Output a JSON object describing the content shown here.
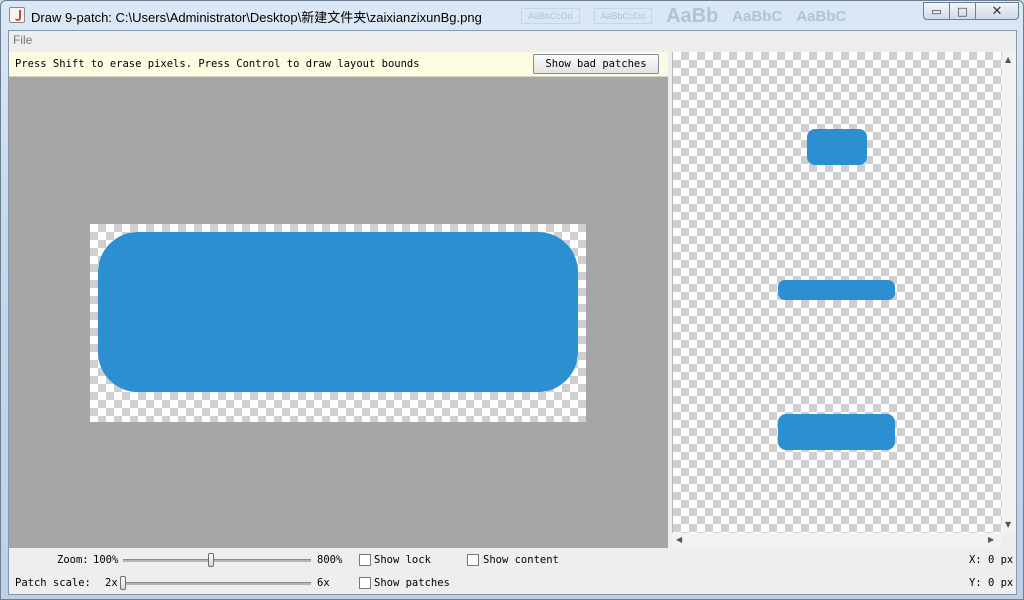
{
  "window": {
    "title": "Draw 9-patch: C:\\Users\\Administrator\\Desktop\\新建文件夹\\zaixianzixunBg.png",
    "min_glyph": "▭",
    "max_glyph": "□",
    "close_glyph": "✕",
    "background_ghost": [
      "AaBbCcDd",
      "AaBbCcDd",
      "AaBb",
      "AaBbC",
      "AaBbC"
    ]
  },
  "menu": {
    "file": "File"
  },
  "hint": {
    "text": "Press Shift to erase pixels. Press Control to draw layout bounds",
    "button": "Show bad patches"
  },
  "colors": {
    "patch_fill": "#2b8fd1",
    "editor_bg": "#a6a6a6",
    "hint_bg": "#fdfbe2"
  },
  "controls": {
    "zoom_label": "Zoom:",
    "zoom_min": "100%",
    "zoom_max": "800%",
    "zoom_value": 0.47,
    "patch_scale_label": "Patch scale:",
    "patch_min": "2x",
    "patch_max": "6x",
    "patch_value": 0,
    "show_lock": "Show lock",
    "show_patches": "Show patches",
    "show_content": "Show content",
    "x_readout": "X: 0 px",
    "y_readout": "Y: 0 px"
  },
  "scroll_glyphs": {
    "up": "▲",
    "down": "▼",
    "left": "◀",
    "right": "▶"
  }
}
